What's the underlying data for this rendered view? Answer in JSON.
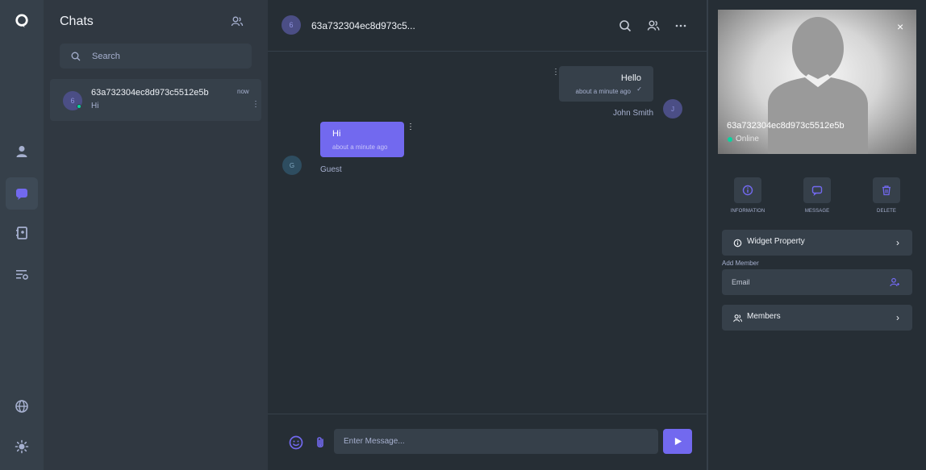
{
  "colors": {
    "accent": "#7269ef",
    "online": "#06d6a0",
    "panel": "#36404a",
    "background": "#262e35"
  },
  "rail": {
    "items": [
      {
        "name": "logo",
        "icon": "app-logo-icon"
      },
      {
        "name": "profile",
        "icon": "user-icon"
      },
      {
        "name": "chats",
        "icon": "chat-bubble-icon",
        "active": true
      },
      {
        "name": "contacts",
        "icon": "contacts-book-icon"
      },
      {
        "name": "settings",
        "icon": "list-settings-icon"
      },
      {
        "name": "language",
        "icon": "globe-icon"
      },
      {
        "name": "theme",
        "icon": "sun-icon"
      }
    ]
  },
  "chatlist": {
    "title": "Chats",
    "search_placeholder": "Search",
    "conversations": [
      {
        "avatar": "6",
        "name": "63a732304ec8d973c5512e5b",
        "last_message": "Hi",
        "time": "now",
        "online": true
      }
    ]
  },
  "chat": {
    "header": {
      "avatar": "6",
      "name": "63a732304ec8d973c5..."
    },
    "messages": [
      {
        "side": "right",
        "text": "Hello",
        "time": "about a minute ago",
        "sender": "John Smith",
        "avatar": "J"
      },
      {
        "side": "left",
        "text": "Hi",
        "time": "about a minute ago",
        "sender": "Guest",
        "avatar": "G"
      }
    ],
    "composer": {
      "placeholder": "Enter Message..."
    }
  },
  "profile": {
    "name": "63a732304ec8d973c5512e5b",
    "status": "Online",
    "actions": [
      {
        "label": "INFORMATION",
        "icon": "info-circle-icon"
      },
      {
        "label": "MESSAGE",
        "icon": "message-square-icon"
      },
      {
        "label": "DELETE",
        "icon": "trash-icon"
      }
    ],
    "widget_property": "Widget Property",
    "add_member_label": "Add Member",
    "email_placeholder": "Email",
    "members": "Members"
  }
}
